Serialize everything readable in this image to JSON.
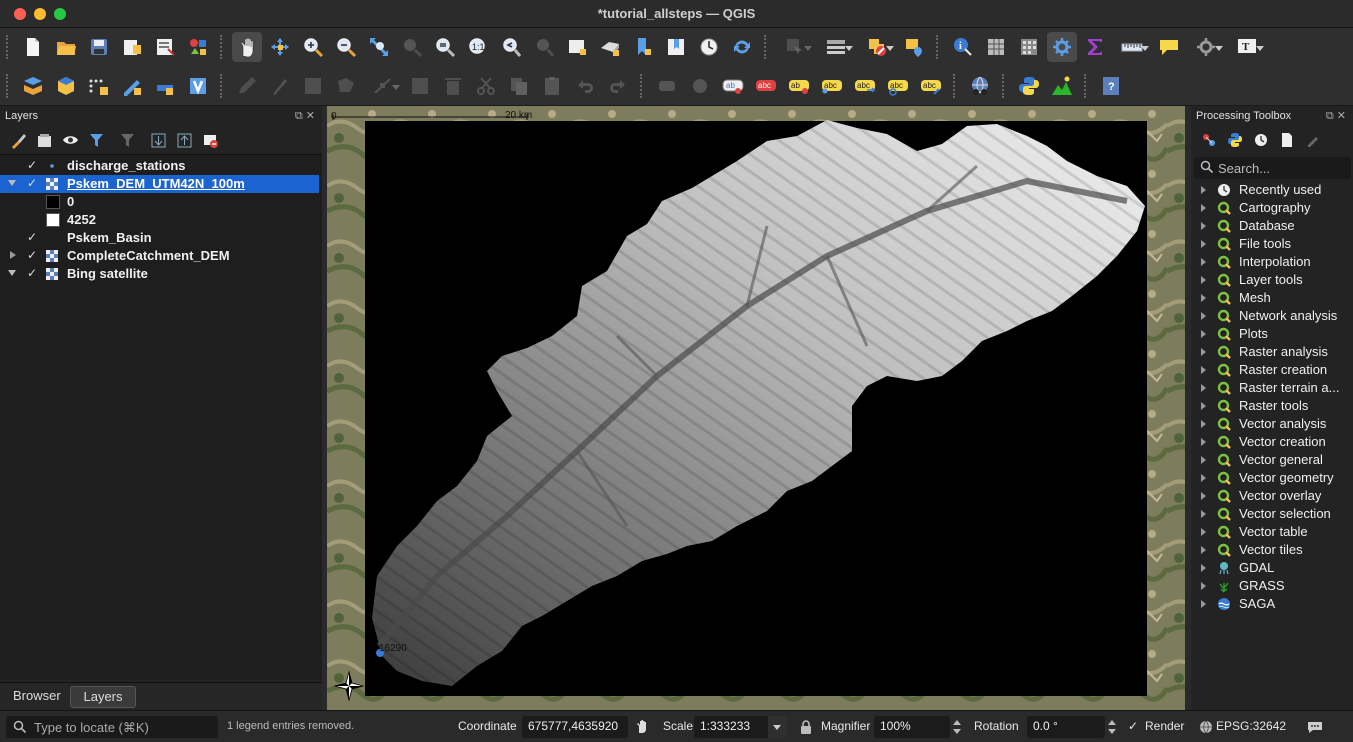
{
  "window": {
    "title": "*tutorial_allsteps — QGIS"
  },
  "toolbar_icons_row1": [
    "new-project-icon",
    "open-project-icon",
    "save-project-icon",
    "new-print-layout-icon",
    "layout-manager-icon",
    "style-manager-icon",
    "pan-map-icon",
    "pan-to-selection-icon",
    "zoom-in-icon",
    "zoom-out-icon",
    "zoom-full-icon",
    "zoom-to-selection-icon",
    "zoom-to-layer-icon",
    "zoom-native-icon",
    "zoom-last-icon",
    "zoom-next-icon",
    "new-map-view-icon",
    "new-3d-view-icon",
    "new-bookmark-icon",
    "show-bookmarks-icon",
    "temporal-controller-icon",
    "refresh-icon",
    "select-features-icon",
    "attribute-table-icon",
    "deselect-icon",
    "select-by-location-icon",
    "identify-icon",
    "open-table-icon",
    "field-calculator-icon",
    "processing-toolbox-icon",
    "statistics-sum-icon",
    "measure-icon",
    "map-tips-icon",
    "annotation-icon",
    "text-annotation-icon"
  ],
  "toolbar_icons_row2": [
    "data-source-manager-icon",
    "new-geopackage-layer-icon",
    "new-temp-scratch-layer-icon",
    "digitize-icon",
    "add-vector-layer-icon",
    "virtual-layer-icon",
    "edit-pencil-icon",
    "toggle-edit-icon",
    "save-edits-icon",
    "add-feature-icon",
    "vertex-tool-icon",
    "modify-attributes-icon",
    "delete-selected-icon",
    "cut-features-icon",
    "copy-features-icon",
    "paste-features-icon",
    "undo-icon",
    "redo-icon",
    "label-tool-icon",
    "diagram-tool-icon",
    "layer-labeling-icon",
    "layer-labeling-off-icon",
    "pin-labels-icon",
    "highlight-pinned-labels-icon",
    "move-label-icon",
    "rotate-label-icon",
    "change-label-icon",
    "plugin-globe-icon",
    "python-console-icon",
    "terrain-profile-icon",
    "help-icon"
  ],
  "layers_panel": {
    "title": "Layers",
    "items": [
      {
        "name": "discharge_stations",
        "checked": "✓",
        "expanded": false,
        "type": "point",
        "selected": false
      },
      {
        "name": "Pskem_DEM_UTM42N_100m",
        "checked": "✓",
        "expanded": true,
        "type": "raster",
        "selected": true
      },
      {
        "name": "Pskem_Basin",
        "checked": "✓",
        "expanded": false,
        "type": "polygon",
        "selected": false
      },
      {
        "name": "CompleteCatchment_DEM",
        "checked": "✓",
        "expanded": false,
        "type": "raster",
        "selected": false
      },
      {
        "name": "Bing satellite",
        "checked": "✓",
        "expanded": true,
        "type": "raster",
        "selected": false
      }
    ],
    "legend": {
      "min_label": "0",
      "max_label": "4252",
      "min_color": "#000000",
      "max_color": "#ffffff"
    },
    "tabs": {
      "browser": "Browser",
      "layers": "Layers"
    }
  },
  "map": {
    "scale_zero": "0",
    "scale_distance": "20 km",
    "station_label": "16290",
    "station_color": "#3a7bd5"
  },
  "processing_toolbox": {
    "title": "Processing Toolbox",
    "search_placeholder": "Search...",
    "items": [
      {
        "label": "Recently used",
        "icon": "clock-icon"
      },
      {
        "label": "Cartography",
        "icon": "qgis-icon"
      },
      {
        "label": "Database",
        "icon": "qgis-icon"
      },
      {
        "label": "File tools",
        "icon": "qgis-icon"
      },
      {
        "label": "Interpolation",
        "icon": "qgis-icon"
      },
      {
        "label": "Layer tools",
        "icon": "qgis-icon"
      },
      {
        "label": "Mesh",
        "icon": "qgis-icon"
      },
      {
        "label": "Network analysis",
        "icon": "qgis-icon"
      },
      {
        "label": "Plots",
        "icon": "qgis-icon"
      },
      {
        "label": "Raster analysis",
        "icon": "qgis-icon"
      },
      {
        "label": "Raster creation",
        "icon": "qgis-icon"
      },
      {
        "label": "Raster terrain a...",
        "icon": "qgis-icon"
      },
      {
        "label": "Raster tools",
        "icon": "qgis-icon"
      },
      {
        "label": "Vector analysis",
        "icon": "qgis-icon"
      },
      {
        "label": "Vector creation",
        "icon": "qgis-icon"
      },
      {
        "label": "Vector general",
        "icon": "qgis-icon"
      },
      {
        "label": "Vector geometry",
        "icon": "qgis-icon"
      },
      {
        "label": "Vector overlay",
        "icon": "qgis-icon"
      },
      {
        "label": "Vector selection",
        "icon": "qgis-icon"
      },
      {
        "label": "Vector table",
        "icon": "qgis-icon"
      },
      {
        "label": "Vector tiles",
        "icon": "qgis-icon"
      },
      {
        "label": "GDAL",
        "icon": "gdal-icon"
      },
      {
        "label": "GRASS",
        "icon": "grass-icon"
      },
      {
        "label": "SAGA",
        "icon": "saga-icon"
      }
    ]
  },
  "statusbar": {
    "locate_placeholder": "Type to locate (⌘K)",
    "message": "1 legend entries removed.",
    "coordinate_label": "Coordinate",
    "coordinate_value": "675777,4635920",
    "scale_label": "Scale",
    "scale_value": "1:333233",
    "magnifier_label": "Magnifier",
    "magnifier_value": "100%",
    "rotation_label": "Rotation",
    "rotation_value": "0.0 °",
    "render_check": "✓",
    "render_label": "Render",
    "crs": "EPSG:32642"
  },
  "colors": {
    "selection": "#1a63d0",
    "qgis_green": "#7cc142",
    "dem_dark": "#000000",
    "dem_light": "#ffffff"
  }
}
